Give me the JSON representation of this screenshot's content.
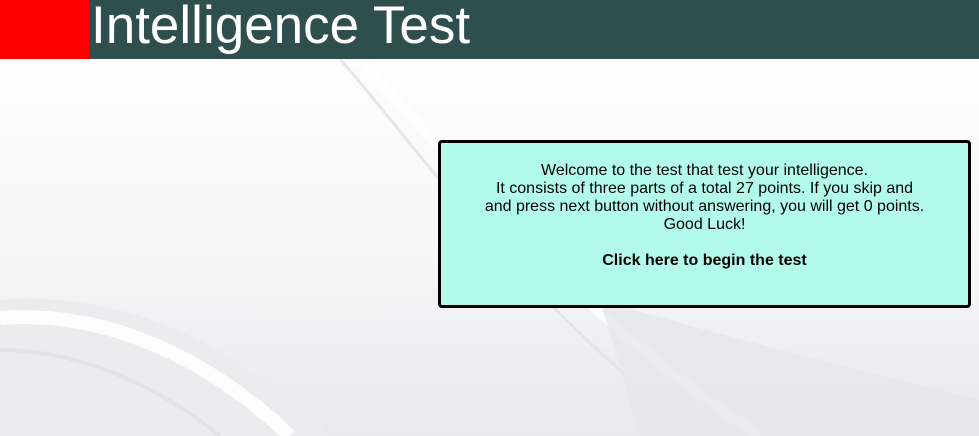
{
  "header": {
    "title": "Intelligence Test",
    "accent_color": "#ff0000",
    "bar_color": "#2f4f4f"
  },
  "welcome": {
    "lines": [
      "Welcome to the test that test your intelligence.",
      "It consists of three parts of a total 27 points. If you skip and",
      "and press next button without answering, you will get 0 points.",
      "Good Luck!"
    ],
    "begin_link": "Click here to begin the test",
    "box_color": "#b2fbec"
  }
}
